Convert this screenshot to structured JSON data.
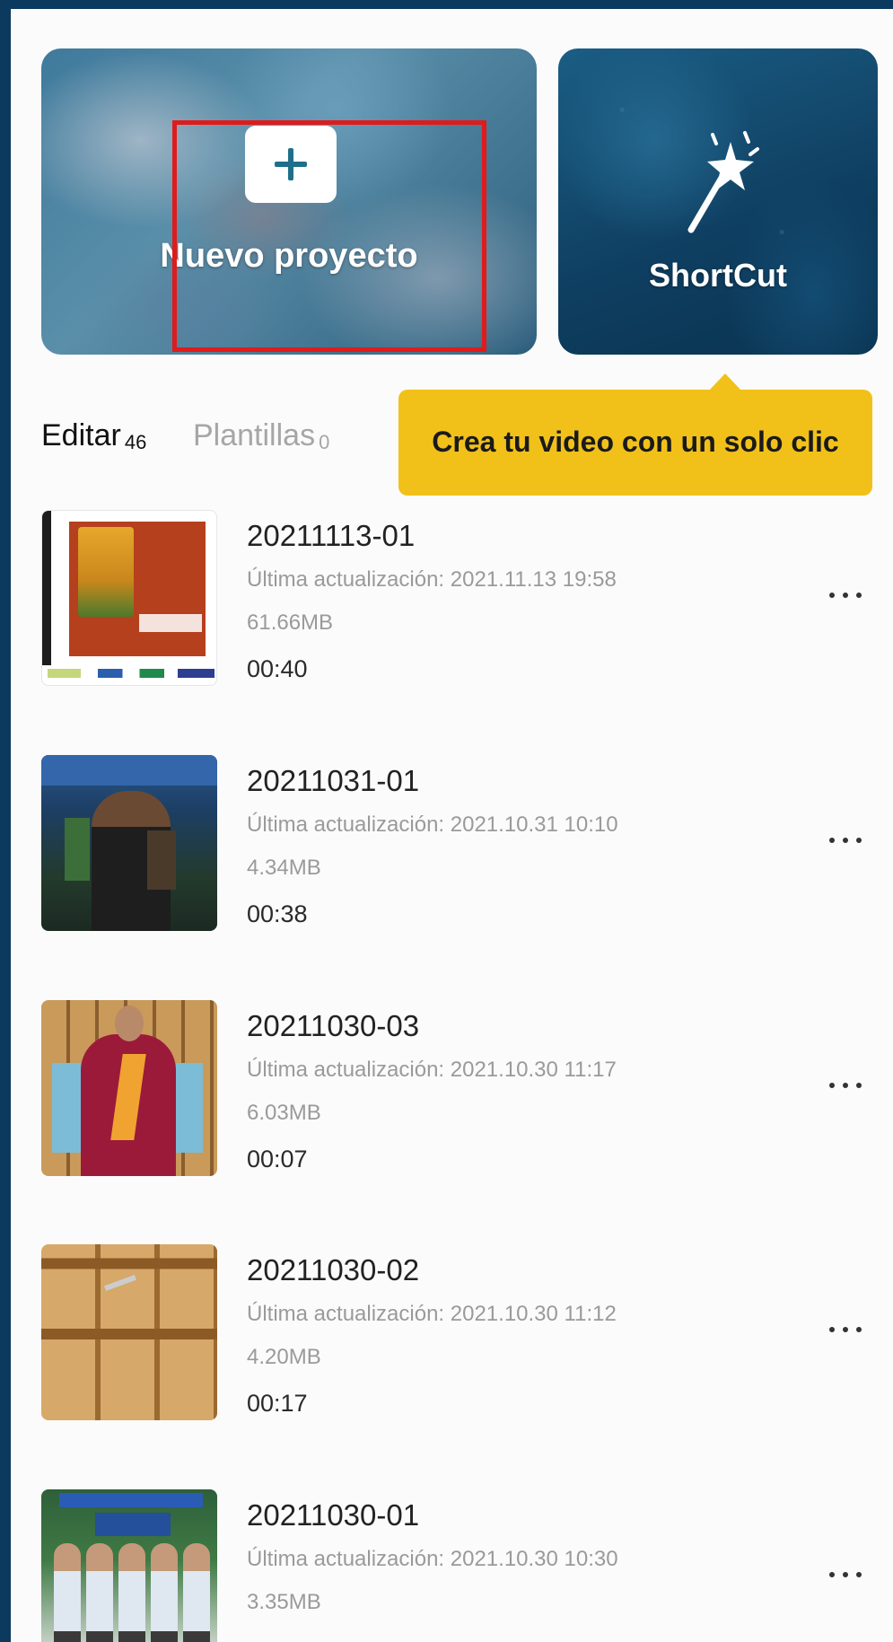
{
  "cards": {
    "new_project": {
      "label": "Nuevo proyecto",
      "icon": "plus-icon"
    },
    "shortcut": {
      "label": "ShortCut",
      "icon": "magic-wand-icon"
    }
  },
  "tooltip": {
    "text": "Crea tu video con un solo clic",
    "color": "#f1c11a"
  },
  "tabs": [
    {
      "label": "Editar",
      "count": "46",
      "active": true
    },
    {
      "label": "Plantillas",
      "count": "0",
      "active": false
    }
  ],
  "projects": [
    {
      "name": "20211113-01",
      "updated": "Última actualización: 2021.11.13 19:58",
      "size": "61.66MB",
      "duration": "00:40"
    },
    {
      "name": "20211031-01",
      "updated": "Última actualización: 2021.10.31 10:10",
      "size": "4.34MB",
      "duration": "00:38"
    },
    {
      "name": "20211030-03",
      "updated": "Última actualización: 2021.10.30 11:17",
      "size": "6.03MB",
      "duration": "00:07"
    },
    {
      "name": "20211030-02",
      "updated": "Última actualización: 2021.10.30 11:12",
      "size": "4.20MB",
      "duration": "00:17"
    },
    {
      "name": "20211030-01",
      "updated": "Última actualización: 2021.10.30 10:30",
      "size": "3.35MB"
    }
  ],
  "colors": {
    "frame": "#0b3a5e",
    "highlight": "#e01b1b",
    "accent_icon": "#1f6f8b"
  }
}
